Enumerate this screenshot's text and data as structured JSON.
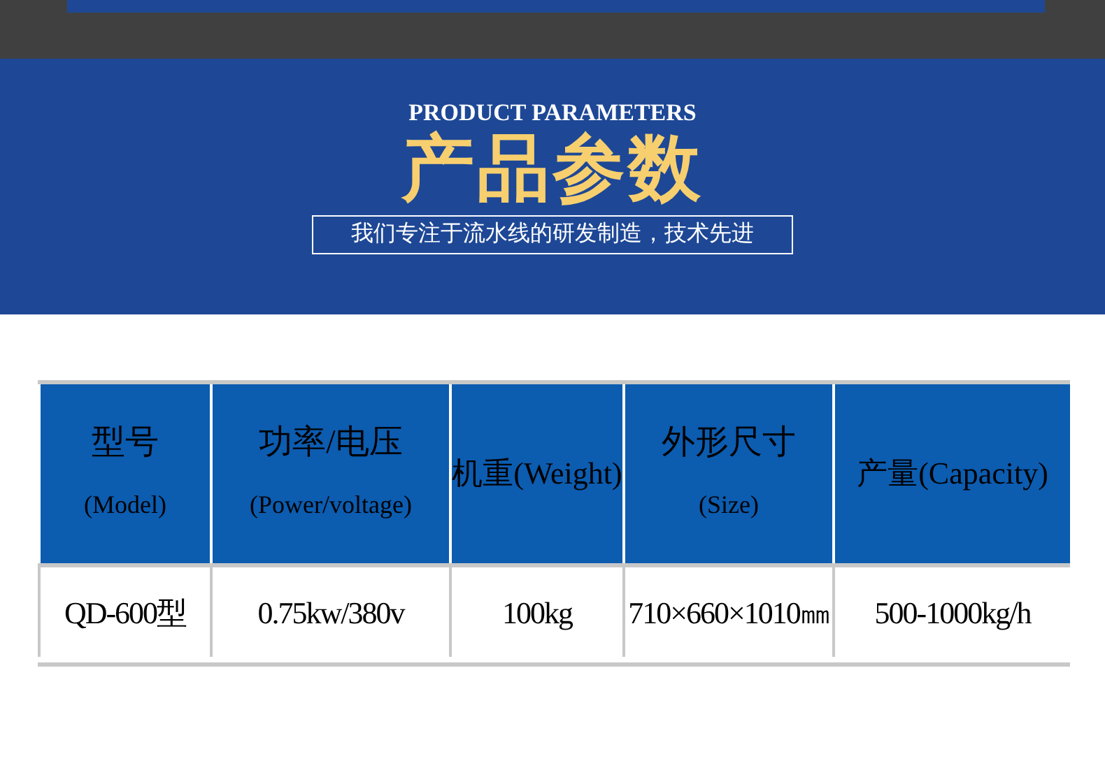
{
  "banner": {
    "subtitle": "PRODUCT PARAMETERS",
    "title": "产品参数",
    "tagline": "我们专注于流水线的研发制造，技术先进"
  },
  "table": {
    "columns": [
      {
        "lines": [
          "型号",
          "(Model)"
        ]
      },
      {
        "lines": [
          "功率/电压",
          "(Power/voltage)"
        ]
      },
      {
        "lines": [
          "机重(Weight)"
        ]
      },
      {
        "lines": [
          "外形尺寸",
          "(Size)"
        ]
      },
      {
        "lines": [
          "产量(Capacity)"
        ]
      }
    ],
    "rows": [
      [
        "QD-600型",
        "0.75kw/380v",
        "100kg",
        "710×660×1010㎜",
        "500-1000kg/h"
      ]
    ]
  }
}
